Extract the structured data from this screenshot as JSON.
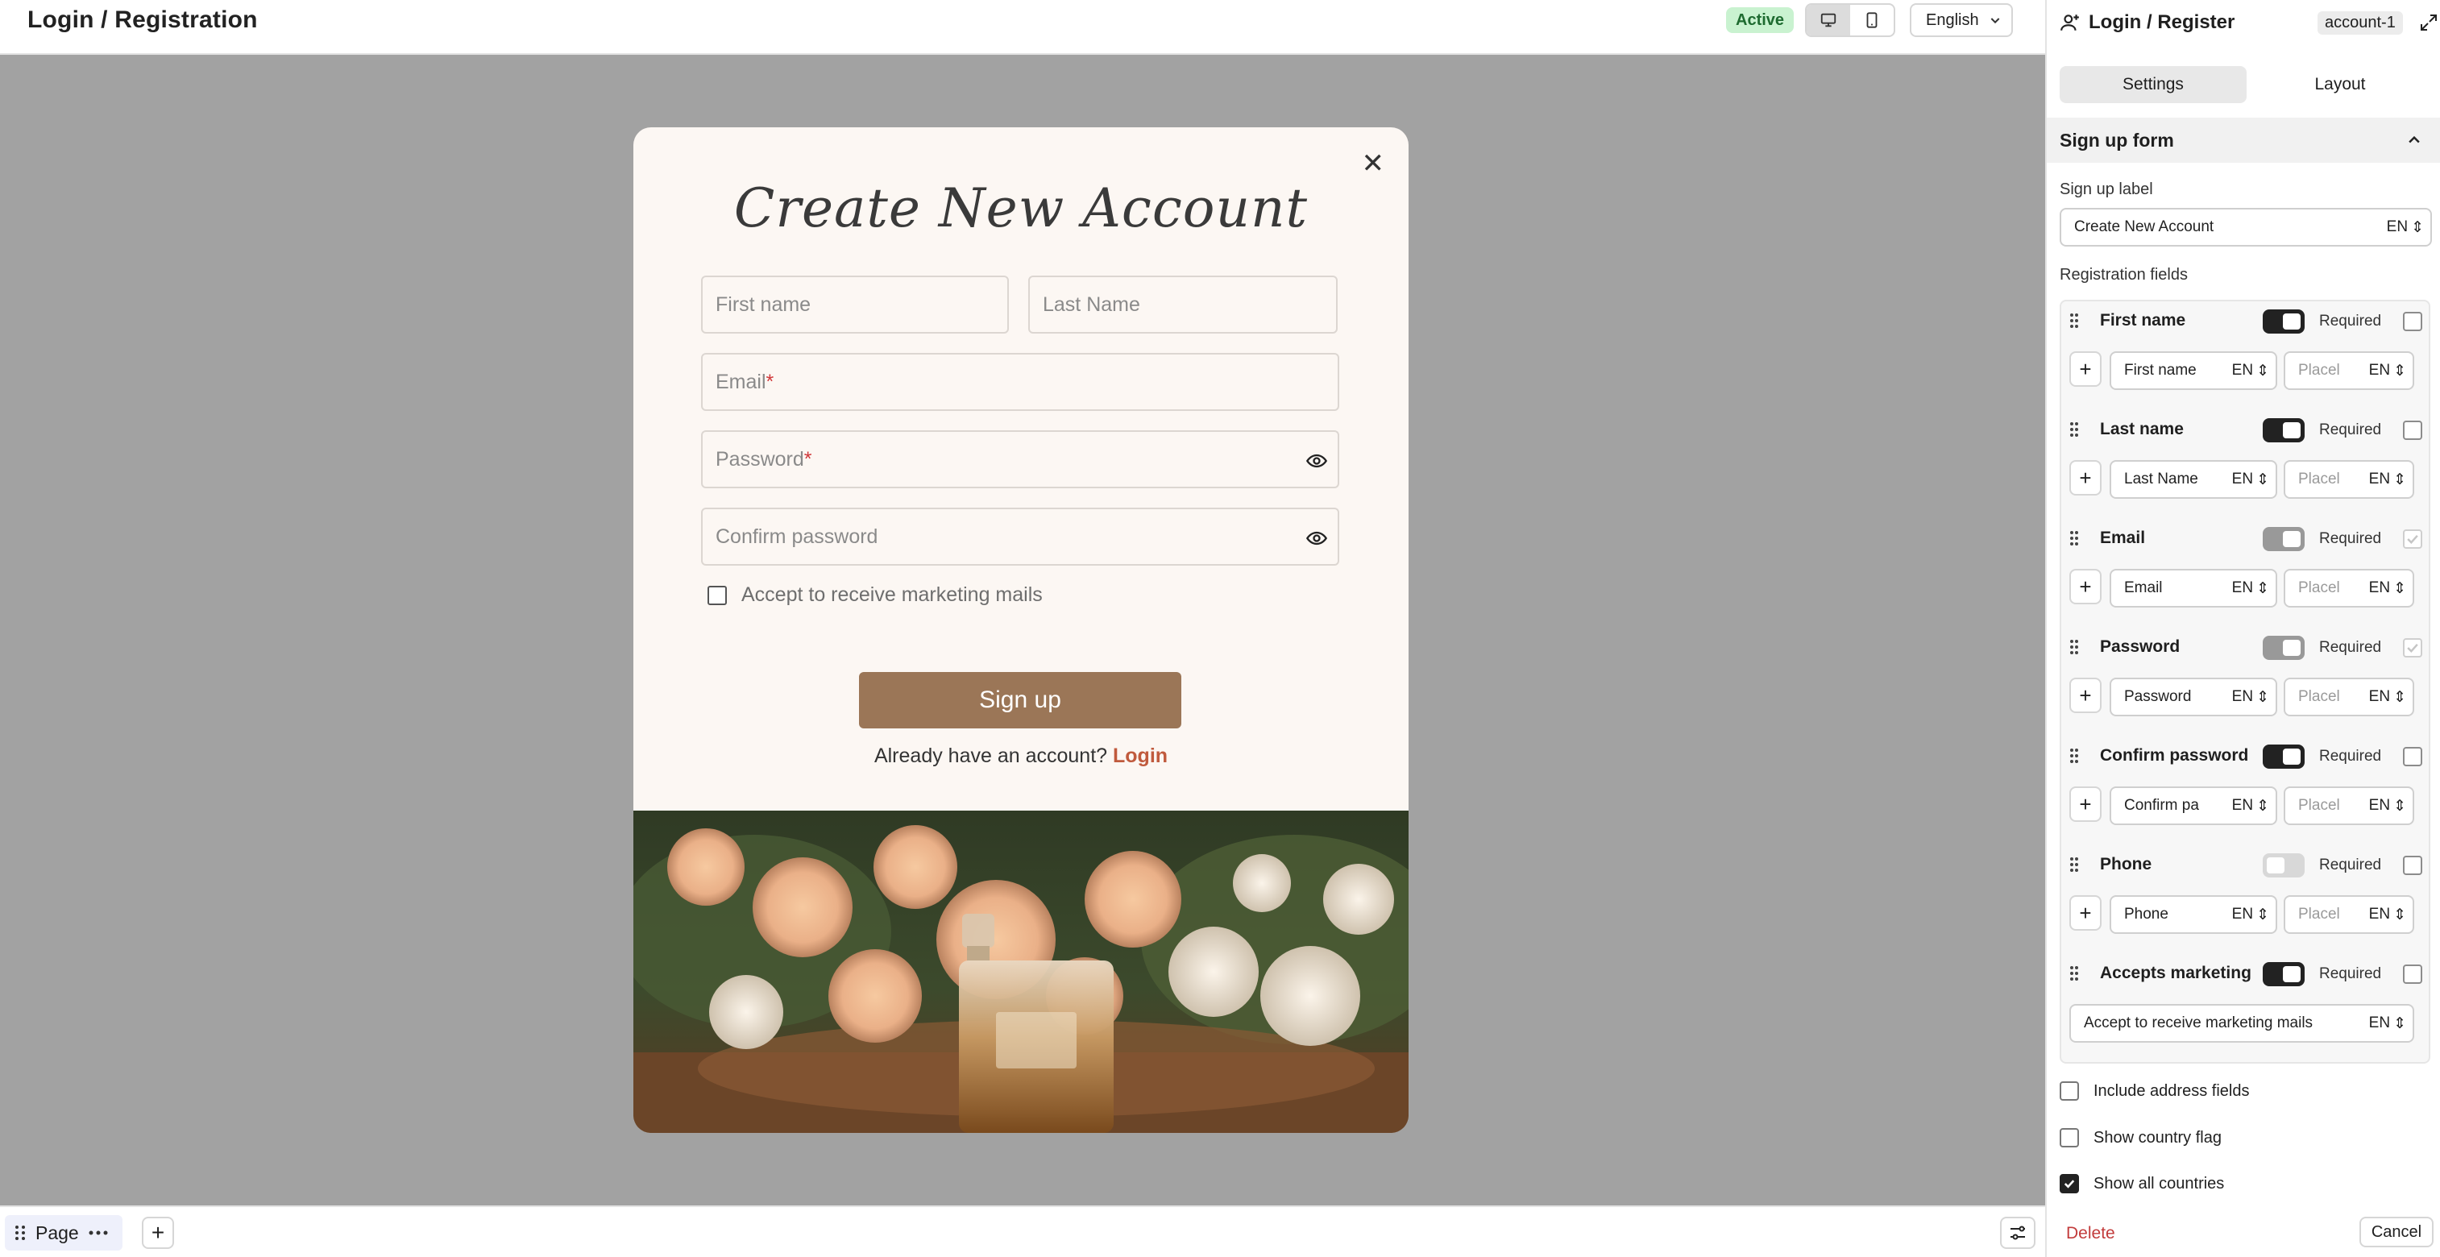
{
  "topbar": {
    "title": "Login / Registration",
    "status": "Active",
    "language": "English"
  },
  "modal": {
    "title": "Create New Account",
    "first_name_placeholder": "First name",
    "last_name_placeholder": "Last Name",
    "email_placeholder": "Email",
    "password_placeholder": "Password",
    "confirm_placeholder": "Confirm password",
    "required_mark": "*",
    "marketing_label": "Accept to receive marketing mails",
    "signup_label": "Sign up",
    "already_text": "Already have an account?",
    "login_link": "Login"
  },
  "bottombar": {
    "page_label": "Page"
  },
  "panel": {
    "title": "Login / Register",
    "account": "account-1",
    "tabs": [
      "Settings",
      "Layout"
    ],
    "section_title": "Sign up form",
    "signup_label_label": "Sign up label",
    "signup_label_value": "Create New Account",
    "lang_code": "EN",
    "registration_fields_label": "Registration fields",
    "required_label": "Required",
    "placeholder_short": "Placel",
    "fields": [
      {
        "name": "First name",
        "label_value": "First name"
      },
      {
        "name": "Last name",
        "label_value": "Last Name"
      },
      {
        "name": "Email",
        "label_value": "Email"
      },
      {
        "name": "Password",
        "label_value": "Password"
      },
      {
        "name": "Confirm password",
        "label_value": "Confirm pa"
      },
      {
        "name": "Phone",
        "label_value": "Phone"
      },
      {
        "name": "Accepts marketing",
        "label_value": "Accept to receive marketing mails"
      }
    ],
    "options": [
      "Include address fields",
      "Show country flag",
      "Show all countries"
    ],
    "delete_label": "Delete",
    "cancel_label": "Cancel"
  }
}
